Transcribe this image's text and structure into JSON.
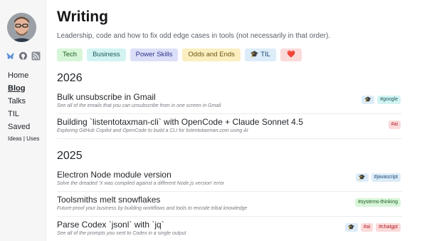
{
  "site": {
    "sidebar": {
      "nav": [
        {
          "label": "Home",
          "active": false
        },
        {
          "label": "Blog",
          "active": true
        },
        {
          "label": "Talks",
          "active": false
        },
        {
          "label": "TIL",
          "active": false
        },
        {
          "label": "Saved",
          "active": false
        }
      ],
      "small_links": {
        "ideas": "Ideas",
        "separator": "|",
        "uses": "Uses"
      },
      "social_icons": [
        "bluesky-icon",
        "github-icon",
        "rss-icon"
      ]
    },
    "header": {
      "title": "Writing",
      "subtitle": "Leadership, code and how to fix odd edge cases in tools (not necessarily in that order)."
    },
    "filter_tags": {
      "tech": "Tech",
      "business": "Business",
      "power": "Power Skills",
      "odds": "Odds and Ends",
      "til_icon": "🎓",
      "til": "TIL",
      "heart": "❤️"
    },
    "sections": [
      {
        "year": "2026",
        "posts": [
          {
            "title": "Bulk unsubscribe in Gmail",
            "desc": "See all of the emails that you can unsubscribe from in one screen in Gmail",
            "cap": "🎓",
            "tags": [
              "#google"
            ]
          },
          {
            "title": "Building `listentotaxman-cli` with OpenCode + Claude Sonnet 4.5",
            "desc": "Exploring GitHub Copilot and OpenCode to build a CLI for listentotaxman.com using AI",
            "cap": "",
            "tags": [
              "#ai"
            ]
          }
        ]
      },
      {
        "year": "2025",
        "posts": [
          {
            "title": "Electron Node module version",
            "desc": "Solve the dreaded 'X was compiled against a different Node.js version' error",
            "cap": "🎓",
            "tags": [
              "#javascript"
            ]
          },
          {
            "title": "Toolsmiths melt snowflakes",
            "desc": "Future-proof your business by building workflows and tools to encode tribal knowledge",
            "cap": "",
            "tags": [
              "#systems-thinking"
            ]
          },
          {
            "title": "Parse Codex `jsonl` with `jq`",
            "desc": "See all of the prompts you sent to Codex in a single output",
            "cap": "🎓",
            "tags": [
              "#ai",
              "#chatgpt"
            ]
          }
        ]
      }
    ]
  }
}
